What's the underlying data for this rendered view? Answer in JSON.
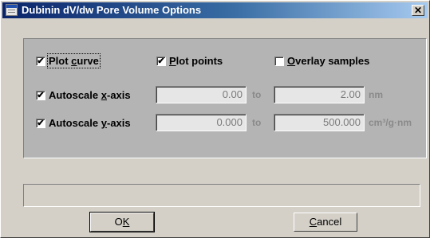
{
  "window": {
    "title": "Dubinin dV/dw Pore Volume Options",
    "close_label": "✕"
  },
  "options": {
    "plot_curve": {
      "pre": "Plot ",
      "key": "c",
      "post": "urve",
      "checked": true
    },
    "plot_points": {
      "pre": "",
      "key": "P",
      "post": "lot points",
      "checked": true
    },
    "overlay_samples": {
      "pre": "",
      "key": "O",
      "post": "verlay samples",
      "checked": false
    }
  },
  "x_axis": {
    "autoscale": {
      "pre": "Autoscale ",
      "key": "x",
      "post": "-axis",
      "checked": true
    },
    "from": "0.00",
    "to_label": "to",
    "to": "2.00",
    "unit": "nm"
  },
  "y_axis": {
    "autoscale": {
      "pre": "Autoscale ",
      "key": "y",
      "post": "-axis",
      "checked": true
    },
    "from": "0.000",
    "to_label": "to",
    "to": "500.000",
    "unit": "cm³/g·nm"
  },
  "buttons": {
    "ok": {
      "pre": "O",
      "key": "K",
      "post": ""
    },
    "cancel": {
      "pre": "",
      "key": "C",
      "post": "ancel"
    }
  },
  "checkmark": "✔"
}
